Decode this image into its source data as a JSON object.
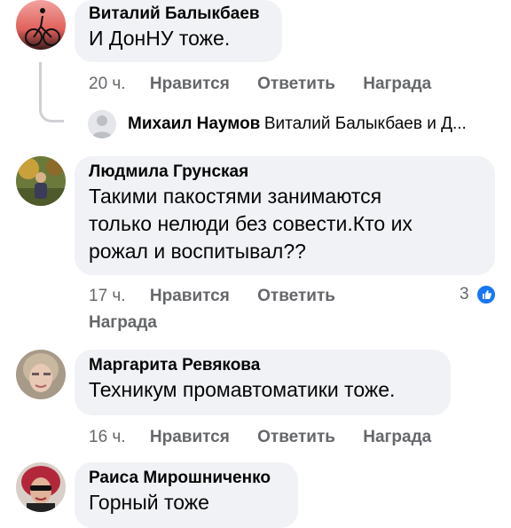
{
  "comments": [
    {
      "author": "Виталий Балыкбаев",
      "text": "И ДонНУ тоже.",
      "time": "20 ч.",
      "like": "Нравится",
      "reply": "Ответить",
      "award": "Награда"
    },
    {
      "author": "Людмила Грунская",
      "text": "Такими пакостями занимаются\nтолько нелюди без совести.Кто их\nрожал и воспитывал??",
      "time": "17 ч.",
      "like": "Нравится",
      "reply": "Ответить",
      "award": "Награда",
      "reactions": "3"
    },
    {
      "author": "Маргарита Ревякова",
      "text": "Техникум промавтоматики  тоже.",
      "time": "16 ч.",
      "like": "Нравится",
      "reply": "Ответить",
      "award": "Награда"
    },
    {
      "author": "Раиса Мирошниченко",
      "text": "Горный тоже"
    }
  ],
  "reply_preview": {
    "name": "Михаил Наумов",
    "preview": "Виталий Балыкбаев и Д..."
  },
  "colors": {
    "bubble": "#f0f2f5",
    "meta": "#65676b",
    "like_badge": "#1877f2"
  }
}
